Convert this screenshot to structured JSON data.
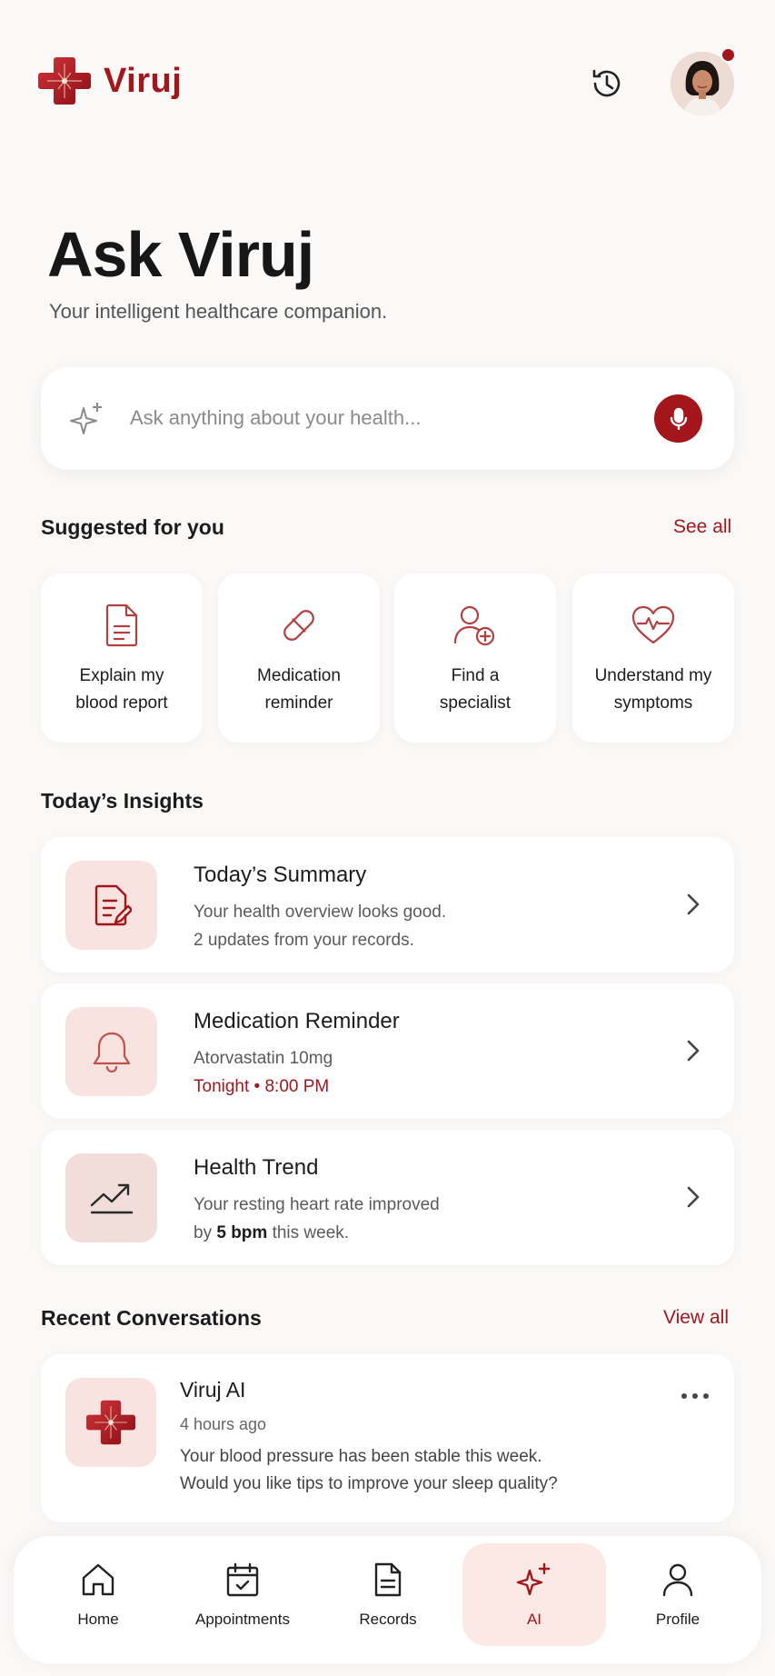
{
  "app": {
    "name": "Viruj",
    "accent_color": "#a3161b",
    "notification_dot_color": "#a3161b"
  },
  "header": {
    "history_icon": "history-icon",
    "avatar": "user-avatar"
  },
  "hero": {
    "title": "Ask Viruj",
    "subtitle": "Your intelligent healthcare companion."
  },
  "search": {
    "placeholder": "Ask anything about your health...",
    "value": "",
    "left_icon": "sparkle-icon",
    "mic_icon": "microphone-icon"
  },
  "suggested": {
    "title": "Suggested for you",
    "link": "See all",
    "items": [
      {
        "icon": "document-icon",
        "line1": "Explain my",
        "line2": "blood report"
      },
      {
        "icon": "pill-icon",
        "line1": "Medication",
        "line2": "reminder"
      },
      {
        "icon": "user-add-icon",
        "line1": "Find a",
        "line2": "specialist"
      },
      {
        "icon": "heart-pulse-icon",
        "line1": "Understand my",
        "line2": "symptoms"
      }
    ]
  },
  "insights": {
    "title": "Today’s Insights",
    "items": [
      {
        "icon": "summary-document-icon",
        "title": "Today’s Summary",
        "line1": "Your health overview looks good.",
        "line2": "2 updates from your records."
      },
      {
        "icon": "bell-icon",
        "title": "Medication Reminder",
        "line1": "Atorvastatin 10mg",
        "line2": "Tonight • 8:00 PM"
      },
      {
        "icon": "trend-up-icon",
        "title": "Health Trend",
        "line1": "Your resting heart rate improved",
        "line2_pre": "by ",
        "line2_bold": "5 bpm",
        "line2_post": " this week."
      }
    ]
  },
  "conversations": {
    "title": "Recent Conversations",
    "link": "View all",
    "items": [
      {
        "name": "Viruj AI",
        "time": "4 hours ago",
        "line1": "Your blood pressure has been stable this week.",
        "line2": "Would you like tips to improve your sleep quality?"
      }
    ]
  },
  "nav": {
    "items": [
      {
        "icon": "home-icon",
        "label": "Home"
      },
      {
        "icon": "calendar-icon",
        "label": "Appointments"
      },
      {
        "icon": "records-icon",
        "label": "Records"
      },
      {
        "icon": "ai-sparkle-icon",
        "label": "AI",
        "active": true
      },
      {
        "icon": "profile-icon",
        "label": "Profile"
      }
    ]
  }
}
